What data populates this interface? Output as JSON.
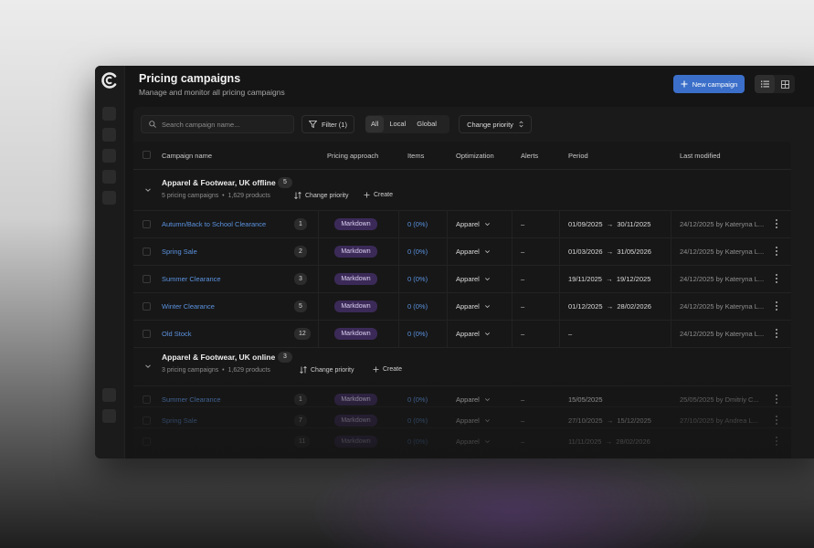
{
  "header": {
    "title": "Pricing campaigns",
    "subtitle": "Manage and monitor all pricing campaigns",
    "new_campaign_label": "New campaign"
  },
  "toolbar": {
    "search_placeholder": "Search campaign name...",
    "filter_label": "Filter (1)",
    "scope_tabs": [
      "All",
      "Local",
      "Global"
    ],
    "scope_selected": "All",
    "priority_label": "Change priority"
  },
  "table": {
    "columns": [
      "Campaign name",
      "Pricing approach",
      "Items",
      "Optimization",
      "Alerts",
      "Period",
      "Last modified"
    ]
  },
  "groups": [
    {
      "title": "Apparel & Footwear, UK offline",
      "count": "5",
      "summary_campaigns": "5 pricing campaigns",
      "summary_products": "1,629 products",
      "change_priority": "Change priority",
      "create": "Create",
      "rows": [
        {
          "name": "Autumn/Back to School Clearance",
          "priority": "1",
          "approach": "Markdown",
          "items": "0 (0%)",
          "optimization": "Apparel",
          "alerts": "–",
          "period_start": "01/09/2025",
          "period_end": "30/11/2025",
          "modified": "24/12/2025 by Kateryna L..."
        },
        {
          "name": "Spring Sale",
          "priority": "2",
          "approach": "Markdown",
          "items": "0 (0%)",
          "optimization": "Apparel",
          "alerts": "–",
          "period_start": "01/03/2026",
          "period_end": "31/05/2026",
          "modified": "24/12/2025 by Kateryna L..."
        },
        {
          "name": "Summer Clearance",
          "priority": "3",
          "approach": "Markdown",
          "items": "0 (0%)",
          "optimization": "Apparel",
          "alerts": "–",
          "period_start": "19/11/2025",
          "period_end": "19/12/2025",
          "modified": "24/12/2025 by Kateryna L..."
        },
        {
          "name": "Winter Clearance",
          "priority": "5",
          "approach": "Markdown",
          "items": "0 (0%)",
          "optimization": "Apparel",
          "alerts": "–",
          "period_start": "01/12/2025",
          "period_end": "28/02/2026",
          "modified": "24/12/2025 by Kateryna L..."
        },
        {
          "name": "Old Stock",
          "priority": "12",
          "approach": "Markdown",
          "items": "0 (0%)",
          "optimization": "Apparel",
          "alerts": "–",
          "period_start": "–",
          "period_end": "",
          "modified": "24/12/2025 by Kateryna L..."
        }
      ]
    },
    {
      "title": "Apparel & Footwear, UK online",
      "count": "3",
      "summary_campaigns": "3 pricing campaigns",
      "summary_products": "1,629 products",
      "change_priority": "Change priority",
      "create": "Create",
      "rows": [
        {
          "name": "Summer Clearance",
          "priority": "1",
          "approach": "Markdown",
          "items": "0 (0%)",
          "optimization": "Apparel",
          "alerts": "–",
          "period_start": "15/05/2025",
          "period_end": "",
          "modified": "25/05/2025 by Dmitriy C..."
        },
        {
          "name": "Spring Sale",
          "priority": "7",
          "approach": "Markdown",
          "items": "0 (0%)",
          "optimization": "Apparel",
          "alerts": "–",
          "period_start": "27/10/2025",
          "period_end": "15/12/2025",
          "modified": "27/10/2025 by Andrea L..."
        },
        {
          "name": "",
          "priority": "11",
          "approach": "Markdown",
          "items": "0 (0%)",
          "optimization": "Apparel",
          "alerts": "–",
          "period_start": "11/11/2025",
          "period_end": "28/02/2026",
          "modified": ""
        }
      ]
    }
  ],
  "icons": {
    "logo": "circular-arc-logo-icon",
    "plus": "plus-icon",
    "list_view": "list-view-icon",
    "grid_view": "grid-view-icon",
    "search": "search-icon",
    "filter": "filter-icon",
    "sort": "sort-arrows-icon",
    "chevron": "chevron-down-icon",
    "more": "more-vertical-icon",
    "arrow": "arrow-right-icon"
  },
  "colors": {
    "accent": "#3b6fc9",
    "link": "#5b93e0",
    "markdown_badge": "#3b2a58"
  }
}
